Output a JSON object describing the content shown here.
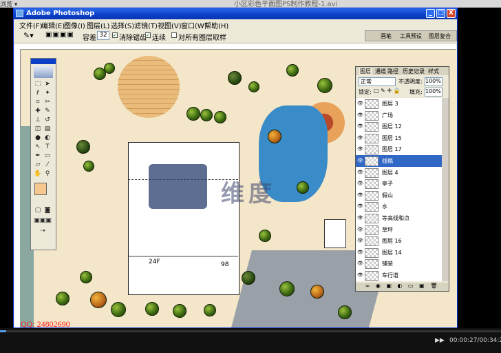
{
  "outer": {
    "corner_label": "浏览 ▾",
    "course_title": "小区彩色平面图PS制作教程-1.avi"
  },
  "window": {
    "title": "Adobe Photoshop",
    "buttons": {
      "minimize": "_",
      "maximize": "□",
      "close": "X"
    }
  },
  "menu": [
    "文件(F)",
    "编辑(E)",
    "图像(I)",
    "图层(L)",
    "选择(S)",
    "滤镜(T)",
    "视图(V)",
    "窗口(W)",
    "帮助(H)"
  ],
  "options": {
    "tolerance_label": "容差:",
    "tolerance_value": "32",
    "antialias_label": "消除锯齿",
    "contiguous_label": "连续",
    "all_layers_label": "对所有图层取样",
    "palette_tabs": [
      "画笔",
      "工具预设",
      "图层复合"
    ]
  },
  "layers_panel": {
    "tabs": [
      "图层",
      "通道",
      "路径",
      "历史记录",
      "样式"
    ],
    "blend_mode": "正常",
    "opacity_label": "不透明度:",
    "opacity_value": "100%",
    "lock_label": "锁定:",
    "fill_label": "填充:",
    "fill_value": "100%",
    "layers": [
      {
        "name": "图层 3",
        "selected": false
      },
      {
        "name": "广场",
        "selected": false
      },
      {
        "name": "图层 12",
        "selected": false
      },
      {
        "name": "图层 15",
        "selected": false
      },
      {
        "name": "图层 17",
        "selected": false
      },
      {
        "name": "线稿",
        "selected": true
      },
      {
        "name": "图层 4",
        "selected": false
      },
      {
        "name": "亭子",
        "selected": false
      },
      {
        "name": "假山",
        "selected": false
      },
      {
        "name": "水",
        "selected": false
      },
      {
        "name": "等高线和点",
        "selected": false
      },
      {
        "name": "草坪",
        "selected": false
      },
      {
        "name": "图层 16",
        "selected": false
      },
      {
        "name": "图层 14",
        "selected": false
      },
      {
        "name": "铺装",
        "selected": false
      },
      {
        "name": "车行道",
        "selected": false
      }
    ]
  },
  "canvas": {
    "qq_label": "QQ: 24802690",
    "watermark": "维度",
    "building_labels": [
      "24F",
      "98"
    ]
  },
  "player": {
    "time": "00:00:27/00:34:25",
    "progress": 0.013,
    "forward": "▶▶"
  },
  "colors": {
    "accent": "#0b3fc7",
    "selected_row": "#3168c6",
    "qq": "#ff2020"
  }
}
